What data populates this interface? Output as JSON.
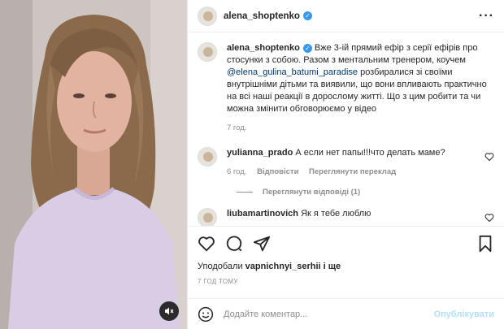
{
  "header": {
    "username": "alena_shoptenko",
    "more_icon": "more-horizontal-icon"
  },
  "caption": {
    "username": "alena_shoptenko",
    "text_part1": "Вже 3-ій прямий ефір з серії ефірів про стосунки з собою. Разом з ментальним тренером, коучем ",
    "mention": "@elena_gulina_batumi_paradise",
    "text_part2": " розбиралися зі своїми внутрішніми дітьми та виявили, що вони впливають практично на всі наші реакції в дорослому житті. Що з цим робити та чи можна змінити обговорюємо у відео",
    "time": "7 год."
  },
  "comments": [
    {
      "username": "yulianna_prado",
      "text": "А если нет папы!!!что делать маме?",
      "time": "6 год.",
      "reply_label": "Відповісти",
      "translate_label": "Переглянути переклад",
      "view_replies": "Переглянути відповіді (1)"
    },
    {
      "username": "liubamartinovich",
      "text": "Як я тебе люблю"
    }
  ],
  "likes": {
    "prefix": "Уподобали ",
    "user": "vapnichnyi_serhii",
    "suffix": " і ще"
  },
  "post_time": "7 ГОД ТОМУ",
  "add_comment": {
    "placeholder": "Додайте коментар...",
    "publish_label": "Опублікувати"
  },
  "colors": {
    "verified": "#3897f0",
    "mention": "#00376b",
    "muted_text": "#8e8e8e",
    "publish_disabled": "#b2dffc",
    "sweater": "#d9cde6"
  }
}
